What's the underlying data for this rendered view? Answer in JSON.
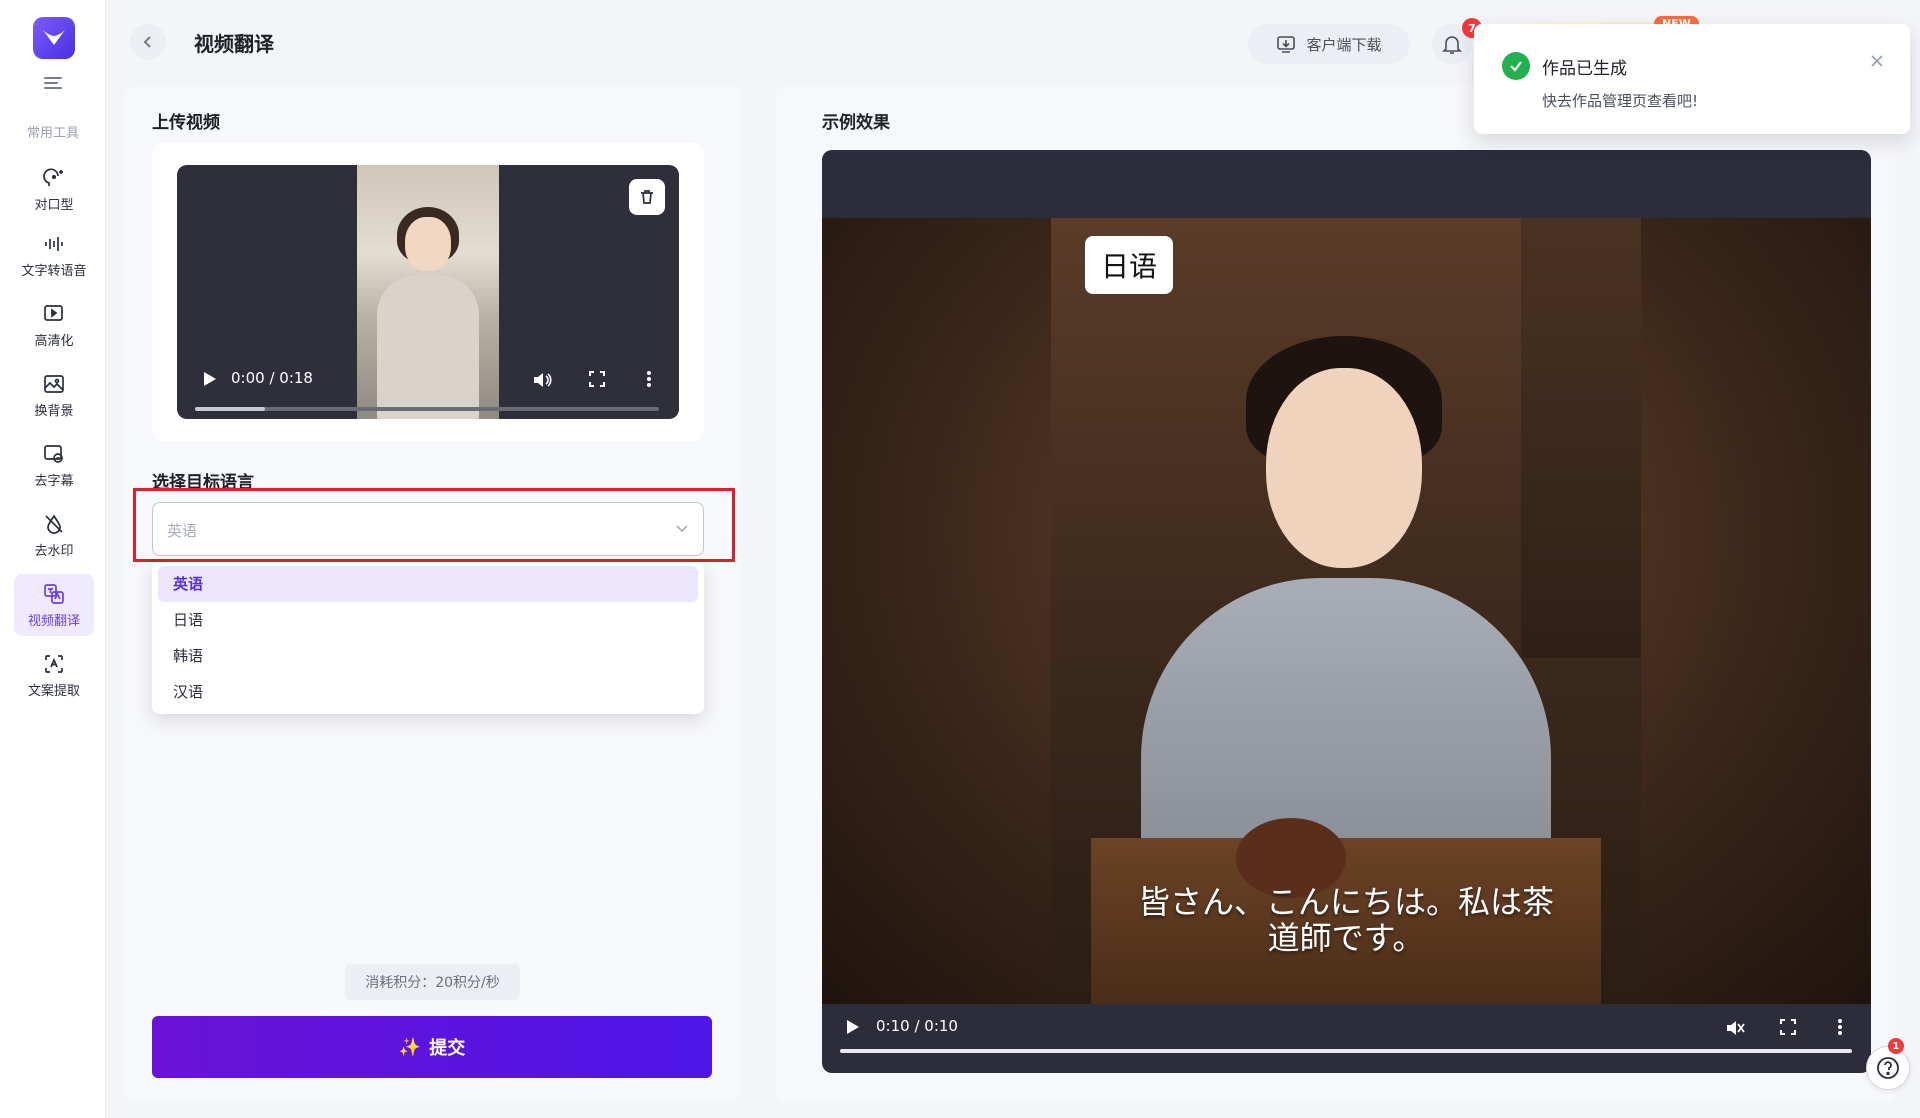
{
  "sidebar": {
    "section_label": "常用工具",
    "items": [
      {
        "label": "对口型",
        "icon": "lip-sync-icon"
      },
      {
        "label": "文字转语音",
        "icon": "text-to-speech-icon"
      },
      {
        "label": "高清化",
        "icon": "hd-icon"
      },
      {
        "label": "换背景",
        "icon": "background-icon"
      },
      {
        "label": "去字幕",
        "icon": "remove-subtitle-icon"
      },
      {
        "label": "去水印",
        "icon": "remove-watermark-icon"
      },
      {
        "label": "视频翻译",
        "icon": "video-translate-icon",
        "active": true
      },
      {
        "label": "文案提取",
        "icon": "text-extract-icon"
      }
    ]
  },
  "header": {
    "title": "视频翻译",
    "download_label": "客户端下载",
    "notification_count": "7",
    "new_badge": "NEW"
  },
  "upload": {
    "section_label": "上传视频",
    "time": "0:00 / 0:18",
    "progress": 0.15
  },
  "language": {
    "section_label": "选择目标语言",
    "placeholder": "英语",
    "options": [
      "英语",
      "日语",
      "韩语",
      "汉语"
    ],
    "selected": "英语"
  },
  "cost_label": "消耗积分：20积分/秒",
  "submit_label": "提交",
  "example": {
    "section_label": "示例效果",
    "lang_tag": "日语",
    "subtitle_line1": "皆さん、こんにちは。私は茶",
    "subtitle_line2": "道師です。",
    "time": "0:10 / 0:10"
  },
  "toast": {
    "title": "作品已生成",
    "message": "快去作品管理页查看吧!"
  },
  "help_badge": "1",
  "colors": {
    "accent": "#6b3ef0",
    "submit_start": "#6a11d6",
    "submit_end": "#4e16e8",
    "highlight": "#e11d2a",
    "success": "#22b14c"
  }
}
